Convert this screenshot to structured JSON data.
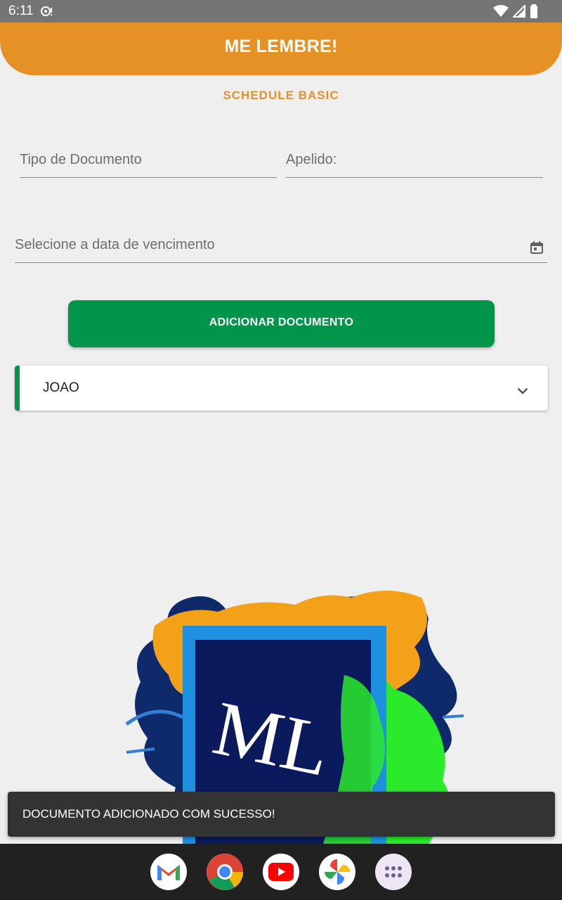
{
  "status_bar": {
    "time": "6:11",
    "icons": [
      "data-saver-icon",
      "wifi-icon",
      "cell-signal-icon",
      "battery-icon"
    ]
  },
  "app": {
    "title": "ME LEMBRE!",
    "subtitle": "SCHEDULE BASIC"
  },
  "form": {
    "document_type_label": "Tipo de Documento",
    "nickname_label": "Apelido:",
    "due_date_label": "Selecione a data de vencimento",
    "add_button_label": "ADICIONAR DOCUMENTO"
  },
  "documents": [
    {
      "label": "JOAO"
    }
  ],
  "logo": {
    "text": "ML"
  },
  "snackbar": {
    "message": "DOCUMENTO ADICIONADO COM SUCESSO!"
  },
  "dock": {
    "apps": [
      "gmail-icon",
      "chrome-icon",
      "youtube-icon",
      "photos-icon",
      "app-drawer-icon"
    ]
  },
  "colors": {
    "accent": "#e69126",
    "primary": "#00954a",
    "background": "#efefef"
  }
}
